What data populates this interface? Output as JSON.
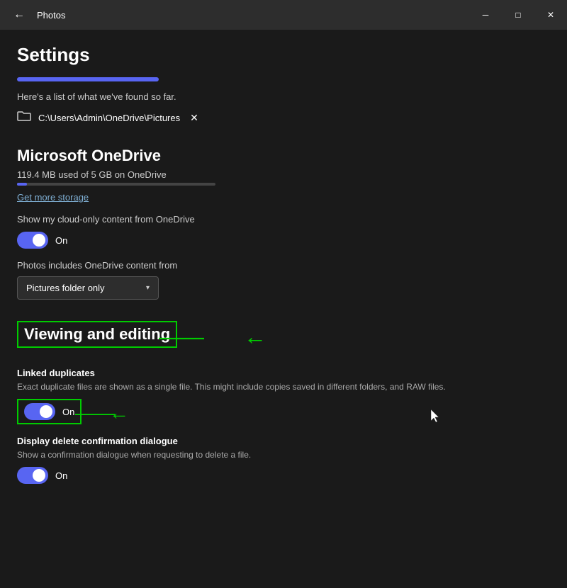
{
  "titleBar": {
    "appName": "Photos",
    "backArrow": "←",
    "minimizeBtn": "─",
    "maximizeBtn": "□",
    "closeBtn": "✕"
  },
  "page": {
    "title": "Settings"
  },
  "foundText": "Here's a list of what we've found so far.",
  "folder": {
    "path": "C:\\Users\\Admin\\OneDrive\\Pictures",
    "removeBtn": "✕"
  },
  "oneDrive": {
    "sectionTitle": "Microsoft OneDrive",
    "storageText": "119.4 MB used of 5 GB on OneDrive",
    "storagePercent": 3,
    "moreStorageLink": "Get more storage",
    "showCloudLabel": "Show my cloud-only content from OneDrive",
    "toggleOnLabel": "On",
    "includesFromLabel": "Photos includes OneDrive content from",
    "dropdownValue": "Pictures folder only",
    "dropdownChevron": "▾"
  },
  "viewingEditing": {
    "sectionTitle": "Viewing and editing",
    "linkedDuplicates": {
      "title": "Linked duplicates",
      "description": "Exact duplicate files are shown as a single file. This might include copies saved in different folders, and RAW files.",
      "toggleLabel": "On"
    },
    "deleteConfirmation": {
      "title": "Display delete confirmation dialogue",
      "description": "Show a confirmation dialogue when requesting to delete a file.",
      "toggleLabel": "On"
    }
  }
}
